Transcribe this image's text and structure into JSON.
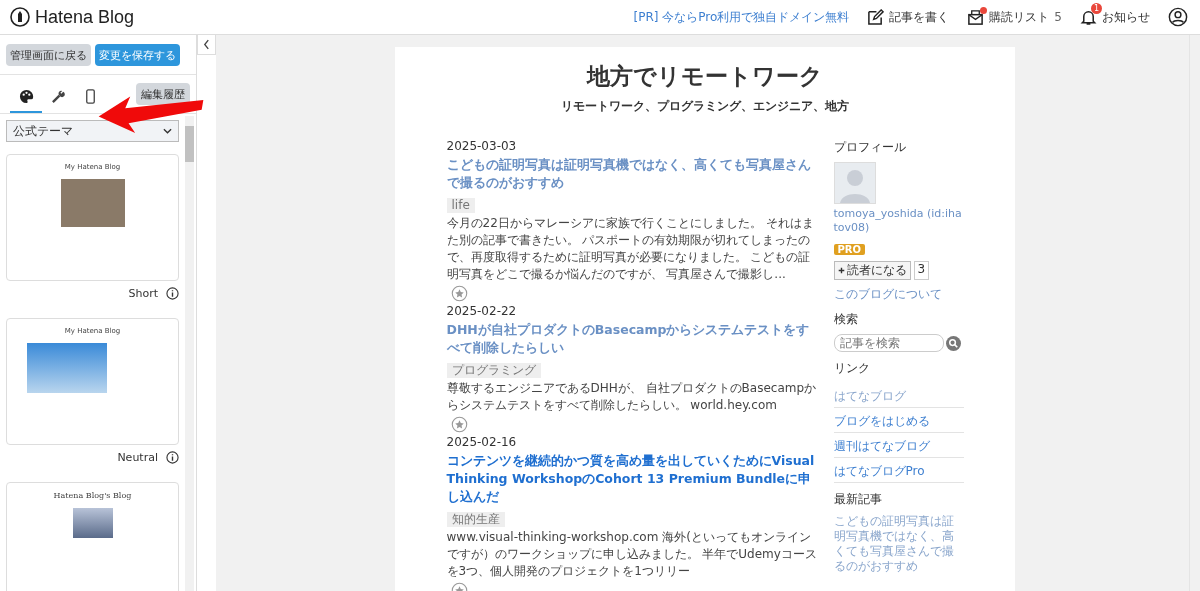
{
  "header": {
    "logo": "Hatena Blog",
    "promo": "[PR] 今ならPro利用で独自ドメイン無料",
    "write": "記事を書く",
    "reading_list": "購読リスト",
    "reading_count": "5",
    "notifications": "お知らせ",
    "notification_badge": "1"
  },
  "editor": {
    "back_button": "管理画面に戻る",
    "save_button": "変更を保存する",
    "tabs": [
      {
        "kind": "design",
        "selected": true
      },
      {
        "kind": "custom",
        "selected": false
      },
      {
        "kind": "mobile",
        "selected": false
      }
    ],
    "history_button": "編集履歴",
    "theme_select": "公式テーマ",
    "themes": [
      {
        "kind": "short",
        "preview_title": "My Hatena Blog",
        "name": "Short"
      },
      {
        "kind": "neutral",
        "preview_title": "My Hatena Blog",
        "name": "Neutral"
      },
      {
        "kind": "serif",
        "preview_title": "Hatena Blog's Blog"
      }
    ]
  },
  "blog": {
    "title": "地方でリモートワーク",
    "description": "リモートワーク、プログラミング、エンジニア、地方",
    "posts": [
      {
        "date": "2025-03-03",
        "title": "こどもの証明写真は証明写真機ではなく、高くても写真屋さんで撮るのがおすすめ",
        "visited": true,
        "tag": "life",
        "excerpt": "今月の22日からマレーシアに家族で行くことにしました。 それはまた別の記事で書きたい。 パスポートの有効期限が切れてしまったので、再度取得するために証明写真が必要になりました。 こどもの証明写真をどこで撮るか悩んだのですが、 写真屋さんで撮影し..."
      },
      {
        "date": "2025-02-22",
        "title": "DHHが自社プロダクトのBasecampからシステムテストをすべて削除したらしい",
        "visited": true,
        "tag": "プログラミング",
        "excerpt": "尊敬するエンジニアであるDHHが、 自社プロダクトのBasecampからシステムテストをすべて削除したらしい。 world.hey.com"
      },
      {
        "date": "2025-02-16",
        "title": "コンテンツを継続的かつ質を高め量を出していくためにVisual Thinking WorkshopのCohort 13 Premium Bundleに申し込んだ",
        "visited": false,
        "tag": "知的生産",
        "excerpt": "www.visual-thinking-workshop.com 海外(といってもオンラインですが）のワークショップに申し込みました。 半年でUdemyコースを3つ、個人開発のプロジェクトを1つリリー"
      }
    ],
    "profile": {
      "heading": "プロフィール",
      "user": "tomoya_yoshida (id:ihatov08)",
      "badge": "PRO",
      "subscribe": "読者になる",
      "subscribers": "3",
      "about": "このブログについて"
    },
    "search": {
      "heading": "検索",
      "placeholder": "記事を検索"
    },
    "links": {
      "heading": "リンク",
      "items": [
        {
          "label": "はてなブログ",
          "visited": true
        },
        {
          "label": "ブログをはじめる",
          "visited": false
        },
        {
          "label": "週刊はてなブログ",
          "visited": false
        },
        {
          "label": "はてなブログPro",
          "visited": false
        }
      ]
    },
    "recent": {
      "heading": "最新記事",
      "items": [
        "こどもの証明写真は証明写真機ではなく、高くても写真屋さんで撮るのがおすすめ"
      ]
    }
  }
}
